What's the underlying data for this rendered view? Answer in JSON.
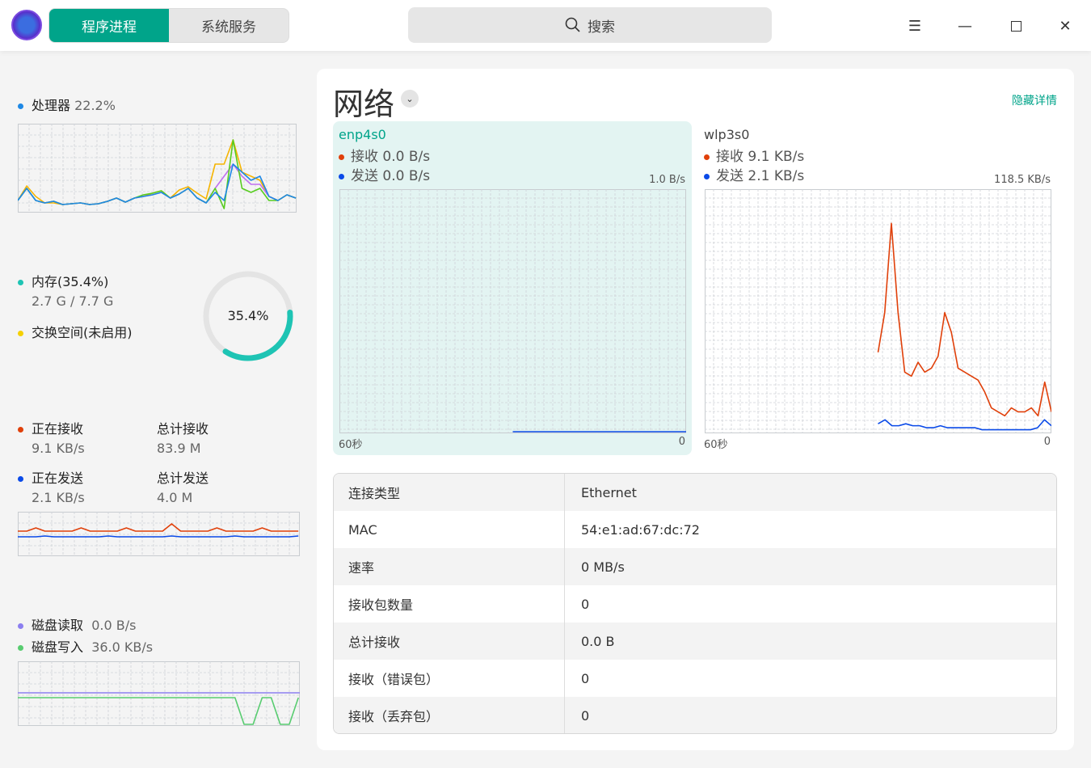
{
  "header": {
    "tabs": [
      "程序进程",
      "系统服务"
    ],
    "search": "搜索"
  },
  "colors": {
    "accent": "#00a48a",
    "recv": "#e0400a",
    "send": "#0a4ae8",
    "cpu": "#1e88e5",
    "mem": "#1ec4b4",
    "swap": "#f5d000",
    "disk_read": "#8c7ff0",
    "disk_write": "#58cc70"
  },
  "cpu": {
    "label": "处理器",
    "value": "22.2%"
  },
  "memory": {
    "label": "内存(35.4%)",
    "usage": "2.7 G / 7.7 G",
    "swap": "交换空间(未启用)",
    "percent_text": "35.4%",
    "percent": 35.4
  },
  "net_summary": {
    "recv_label": "正在接收",
    "recv": "9.1 KB/s",
    "total_recv_label": "总计接收",
    "total_recv": "83.9 M",
    "send_label": "正在发送",
    "send": "2.1 KB/s",
    "total_send_label": "总计发送",
    "total_send": "4.0 M"
  },
  "disk": {
    "read_label": "磁盘读取",
    "read": "0.0 B/s",
    "write_label": "磁盘写入",
    "write": "36.0 KB/s"
  },
  "network": {
    "title": "网络",
    "hide_details": "隐藏详情",
    "interfaces": [
      {
        "name": "enp4s0",
        "recv": "接收 0.0 B/s",
        "send": "发送 0.0 B/s",
        "max": "1.0 B/s",
        "x_left": "60秒",
        "x_right": "0",
        "recv_series": [],
        "send_series": [
          0,
          0,
          0,
          0,
          0,
          0,
          0,
          0,
          0,
          0,
          0
        ]
      },
      {
        "name": "wlp3s0",
        "recv": "接收 9.1 KB/s",
        "send": "发送 2.1 KB/s",
        "max": "118.5 KB/s",
        "x_left": "60秒",
        "x_right": "0",
        "recv_series": [
          40,
          60,
          105,
          60,
          30,
          28,
          35,
          30,
          32,
          38,
          60,
          50,
          32,
          30,
          28,
          26,
          20,
          12,
          10,
          8,
          12,
          10,
          10,
          12,
          8,
          25,
          10
        ],
        "send_series": [
          4,
          6,
          3,
          3,
          4,
          3,
          3,
          2,
          2,
          3,
          2,
          2,
          2,
          2,
          2,
          1,
          1,
          1,
          1,
          1,
          1,
          1,
          1,
          2,
          6,
          3
        ]
      }
    ]
  },
  "details": [
    [
      "连接类型",
      "Ethernet"
    ],
    [
      "MAC",
      "54:e1:ad:67:dc:72"
    ],
    [
      "速率",
      "0 MB/s"
    ],
    [
      "接收包数量",
      "0"
    ],
    [
      "总计接收",
      "0.0 B"
    ],
    [
      "接收（错误包）",
      "0"
    ],
    [
      "接收（丢弃包）",
      "0"
    ]
  ]
}
